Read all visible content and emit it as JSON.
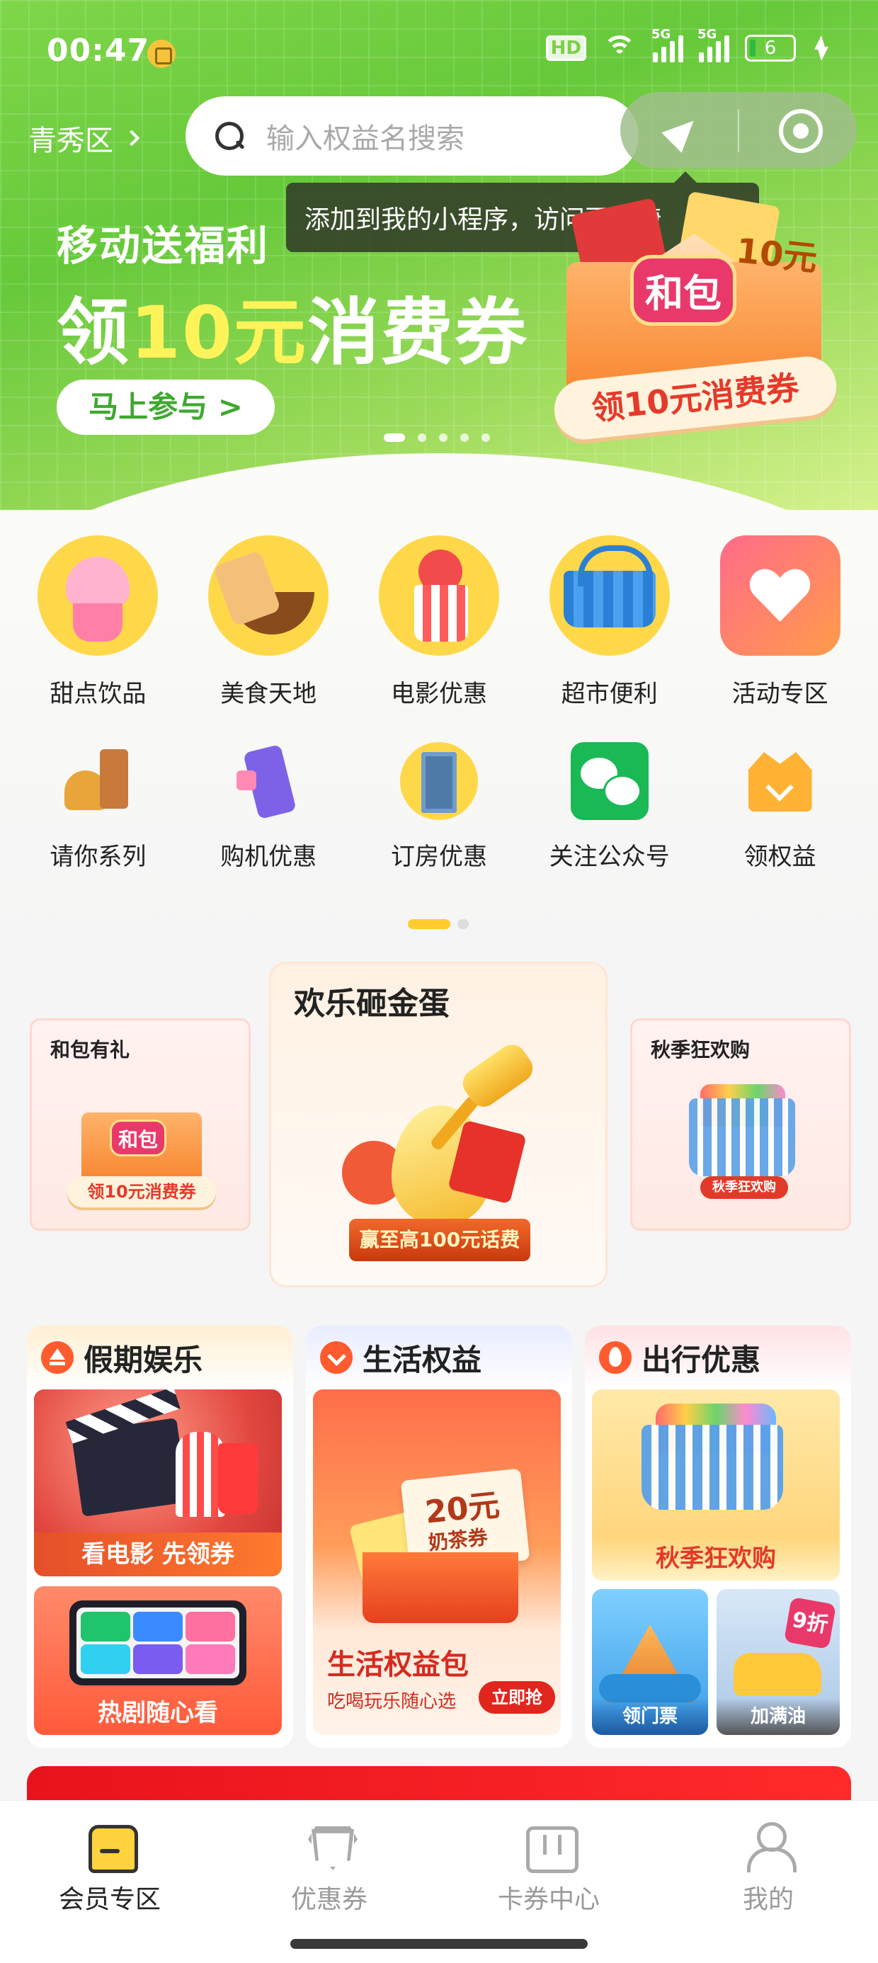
{
  "status_bar": {
    "time": "00:47",
    "hd": "HD",
    "net1": "5G",
    "net2": "5G",
    "battery": "6"
  },
  "header": {
    "district": "青秀区",
    "search_placeholder": "输入权益名搜索",
    "tooltip": "添加到我的小程序，访问更快捷"
  },
  "banner": {
    "kicker": "移动送福利",
    "headline_pre": "领",
    "headline_hl": "10元",
    "headline_post": "消费券",
    "cta": "马上参与 >",
    "art_badge": "和包",
    "art_amount": "10元",
    "art_ribbon": "领10元消费券",
    "slides": 5,
    "active_slide": 0
  },
  "categories": {
    "row1": [
      {
        "label": "甜点饮品",
        "icon": "dessert-icon"
      },
      {
        "label": "美食天地",
        "icon": "food-icon"
      },
      {
        "label": "电影优惠",
        "icon": "movie-icon"
      },
      {
        "label": "超市便利",
        "icon": "supermarket-icon"
      },
      {
        "label": "活动专区",
        "icon": "heart-icon"
      }
    ],
    "row2": [
      {
        "label": "请你系列",
        "icon": "treat-icon"
      },
      {
        "label": "购机优惠",
        "icon": "phone-icon"
      },
      {
        "label": "订房优惠",
        "icon": "hotel-icon"
      },
      {
        "label": "关注公众号",
        "icon": "wechat-icon"
      },
      {
        "label": "领权益",
        "icon": "crown-icon"
      }
    ],
    "pages": 2,
    "active_page": 0
  },
  "carousel": {
    "left": {
      "title": "和包有礼",
      "badge": "和包",
      "ribbon": "领10元消费券"
    },
    "center": {
      "title": "欢乐砸金蛋",
      "ribbon": "赢至高100元话费"
    },
    "right": {
      "title": "秋季狂欢购",
      "ribbon": "秋季狂欢购"
    }
  },
  "sections": {
    "holiday": {
      "title": "假期娱乐",
      "tile1": "看电影  先领券",
      "tile2": "热剧随心看"
    },
    "life": {
      "title": "生活权益",
      "coupon_amount": "20元",
      "coupon_label": "奶茶券",
      "pack_title": "生活权益包",
      "pack_sub": "吃喝玩乐随心选",
      "pack_btn": "立即抢"
    },
    "travel": {
      "title": "出行优惠",
      "tile1": "秋季狂欢购",
      "tile2": "领门票",
      "tile3": "加满油",
      "fuel_badge": "9折"
    }
  },
  "tabbar": {
    "tabs": [
      {
        "label": "会员专区",
        "active": true
      },
      {
        "label": "优惠券",
        "active": false
      },
      {
        "label": "卡券中心",
        "active": false
      },
      {
        "label": "我的",
        "active": false
      }
    ]
  }
}
